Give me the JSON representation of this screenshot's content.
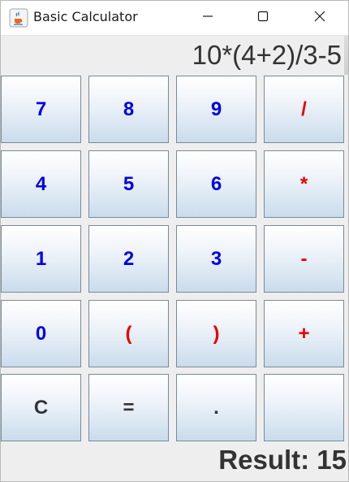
{
  "window": {
    "title": "Basic Calculator",
    "icon": "java-coffee-cup-icon",
    "controls": [
      "minimize-icon",
      "maximize-icon",
      "close-icon"
    ]
  },
  "display": {
    "expression": "10*(4+2)/3-5"
  },
  "keys": [
    {
      "label": "7",
      "kind": "digit"
    },
    {
      "label": "8",
      "kind": "digit"
    },
    {
      "label": "9",
      "kind": "digit"
    },
    {
      "label": "/",
      "kind": "op"
    },
    {
      "label": "4",
      "kind": "digit"
    },
    {
      "label": "5",
      "kind": "digit"
    },
    {
      "label": "6",
      "kind": "digit"
    },
    {
      "label": "*",
      "kind": "op"
    },
    {
      "label": "1",
      "kind": "digit"
    },
    {
      "label": "2",
      "kind": "digit"
    },
    {
      "label": "3",
      "kind": "digit"
    },
    {
      "label": "-",
      "kind": "op"
    },
    {
      "label": "0",
      "kind": "digit"
    },
    {
      "label": "(",
      "kind": "op"
    },
    {
      "label": ")",
      "kind": "op"
    },
    {
      "label": "+",
      "kind": "op"
    },
    {
      "label": "C",
      "kind": "util"
    },
    {
      "label": "=",
      "kind": "util"
    },
    {
      "label": ".",
      "kind": "util"
    },
    {
      "label": "",
      "kind": "util"
    }
  ],
  "result": {
    "text": "Result: 15"
  },
  "colors": {
    "digit": "#0000e6",
    "operator": "#e60000",
    "utility": "#333333",
    "button_gradient_top": "#ffffff",
    "button_gradient_bottom": "#c9dbec",
    "background": "#eeeeee"
  }
}
